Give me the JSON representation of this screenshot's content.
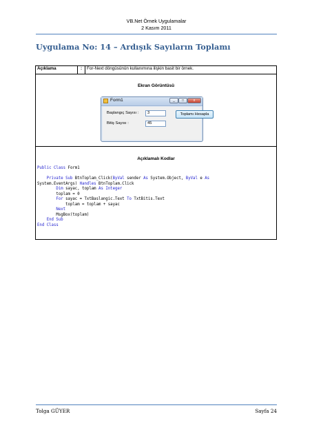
{
  "header": {
    "line1": "VB.Net Örnek Uygulamalar",
    "line2": "2 Kasım 2011"
  },
  "title": "Uygulama No: 14 – Ardışık Sayıların Toplamı",
  "table": {
    "label": "Açıklama",
    "colon": ":",
    "description": "For-Next döngüsünün kullanımına ilişkin basit bir örnek.",
    "screenshot_title": "Ekran Görüntüsü",
    "code_title": "Açıklamalı Kodlar"
  },
  "form": {
    "title": "Form1",
    "min_glyph": "_",
    "max_glyph": "□",
    "close_glyph": "x",
    "label_start": "Başlangıç Sayısı :",
    "value_start": "3",
    "label_end": "Bitiş Sayısı :",
    "value_end": "45",
    "button_label": "Toplamı Hesapla"
  },
  "code": {
    "l1a": "Public Class",
    "l1b": " Form1",
    "l3a": "    Private Sub",
    "l3b": " BtnToplam_Click(",
    "l3c": "ByVal",
    "l3d": " sender ",
    "l3e": "As",
    "l3f": " System.Object, ",
    "l3g": "ByVal",
    "l3h": " e ",
    "l3i": "As",
    "l4a": "System.EventArgs) ",
    "l4b": "Handles",
    "l4c": " BtnToplam.Click",
    "l5a": "        Dim",
    "l5b": " sayac, toplam ",
    "l5c": "As Integer",
    "l6": "        toplam = 0",
    "l7a": "        For",
    "l7b": " sayac = TxtBaslangic.Text ",
    "l7c": "To",
    "l7d": " TxtBitis.Text",
    "l8": "            toplam = toplam + sayac",
    "l9": "        Next",
    "l10": "        MsgBox(toplam)",
    "l11": "    End Sub",
    "l12": "End Class"
  },
  "footer": {
    "author": "Tolga GÜYER",
    "page": "Sayfa 24"
  },
  "colors": {
    "heading": "#365f91",
    "rule": "#4f81bd",
    "keyword": "#1f1fcf"
  }
}
